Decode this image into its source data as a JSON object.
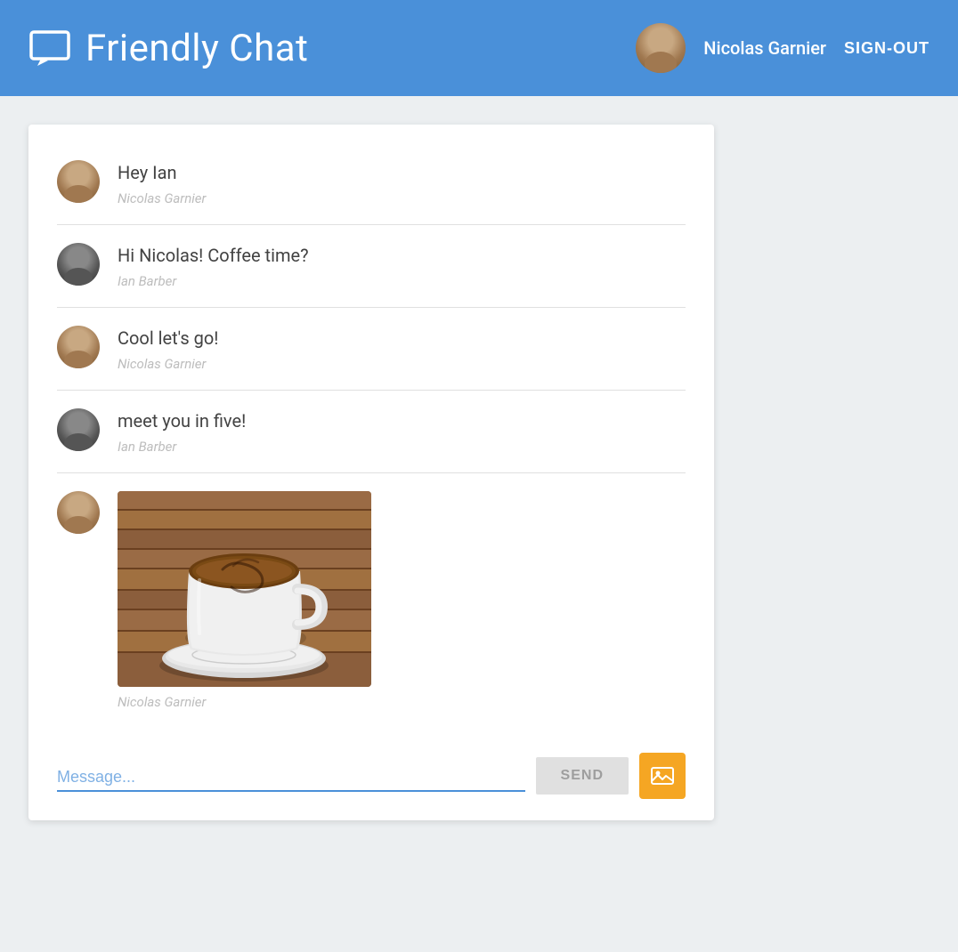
{
  "header": {
    "title": "Friendly Chat",
    "user": {
      "name": "Nicolas Garnier",
      "sign_out_label": "SIGN-OUT"
    }
  },
  "messages": [
    {
      "id": 1,
      "text": "Hey Ian",
      "author": "Nicolas Garnier",
      "avatar_type": "nicolas",
      "has_image": false
    },
    {
      "id": 2,
      "text": "Hi Nicolas! Coffee time?",
      "author": "Ian Barber",
      "avatar_type": "ian",
      "has_image": false
    },
    {
      "id": 3,
      "text": "Cool let's go!",
      "author": "Nicolas Garnier",
      "avatar_type": "nicolas",
      "has_image": false
    },
    {
      "id": 4,
      "text": "meet you in five!",
      "author": "Ian Barber",
      "avatar_type": "ian",
      "has_image": false
    },
    {
      "id": 5,
      "text": "",
      "author": "Nicolas Garnier",
      "avatar_type": "nicolas",
      "has_image": true
    }
  ],
  "input": {
    "placeholder": "Message...",
    "send_label": "SEND"
  },
  "colors": {
    "header_bg": "#4a90d9",
    "send_bg": "#e0e0e0",
    "upload_bg": "#f5a623"
  }
}
